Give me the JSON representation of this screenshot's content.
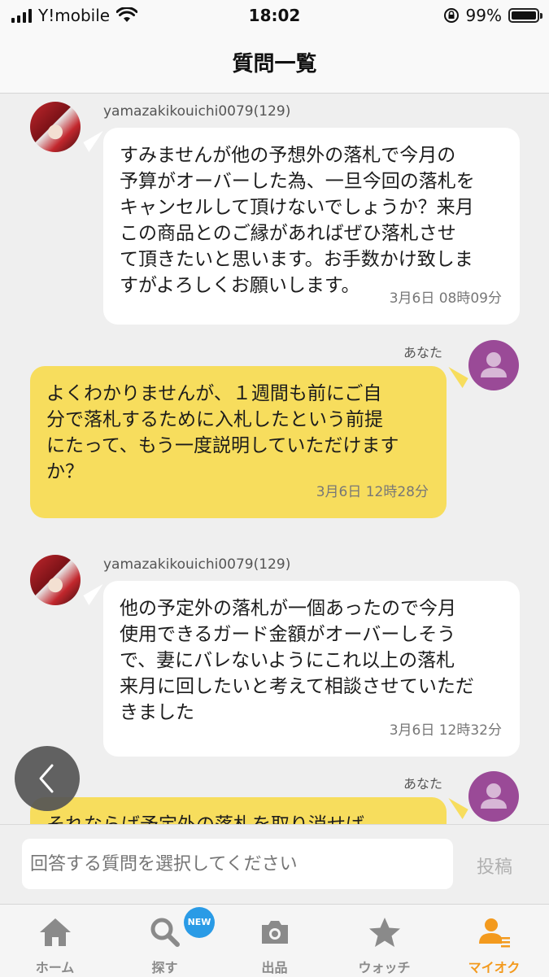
{
  "status_bar": {
    "carrier": "Y!mobile",
    "time": "18:02",
    "battery_percent": "99%",
    "battery_level": 0.99,
    "icons": [
      "signal-icon",
      "wifi-icon",
      "orientation-lock-icon",
      "battery-icon"
    ]
  },
  "header": {
    "title": "質問一覧"
  },
  "messages": [
    {
      "sender": "yamazakikouichi0079(129)",
      "side": "left",
      "text": "すみませんが他の予想外の落札で今月の\n予算がオーバーした為、一旦今回の落札を\nキャンセルして頂けないでしょうか？来月\nこの商品とのご縁があればぜひ落札させ\nて頂きたいと思います。お手数かけ致しま\nすがよろしくお願いします。",
      "time": "3月6日 08時09分"
    },
    {
      "sender": "あなた",
      "side": "right",
      "text": "よくわかりませんが、１週間も前にご自\n分で落札するために入札したという前提\nにたって、もう一度説明していただけます\nか？",
      "time": "3月6日 12時28分"
    },
    {
      "sender": "yamazakikouichi0079(129)",
      "side": "left",
      "text": "他の予定外の落札が一個あったので今月\n使用できるガード金額がオーバーしそう\nで、妻にバレないようにこれ以上の落札\n来月に回したいと考えて相談させていただ\nきました",
      "time": "3月6日 12時32分"
    },
    {
      "sender": "あなた",
      "side": "right",
      "text": "それならば予定外の落札を取り消せば",
      "time": ""
    }
  ],
  "input": {
    "placeholder": "回答する質問を選択してください",
    "submit_label": "投稿"
  },
  "tab_bar": {
    "new_badge": "NEW",
    "active_color": "#f39a1e",
    "items": [
      {
        "label": "ホーム",
        "icon": "home-icon"
      },
      {
        "label": "探す",
        "icon": "search-icon"
      },
      {
        "label": "出品",
        "icon": "camera-icon"
      },
      {
        "label": "ウォッチ",
        "icon": "star-icon"
      },
      {
        "label": "マイオク",
        "icon": "my-auction-icon"
      }
    ]
  },
  "colors": {
    "incoming_bubble": "#ffffff",
    "outgoing_bubble": "#f7dd5d",
    "background": "#efefef",
    "your_avatar": "#9a4a97"
  }
}
